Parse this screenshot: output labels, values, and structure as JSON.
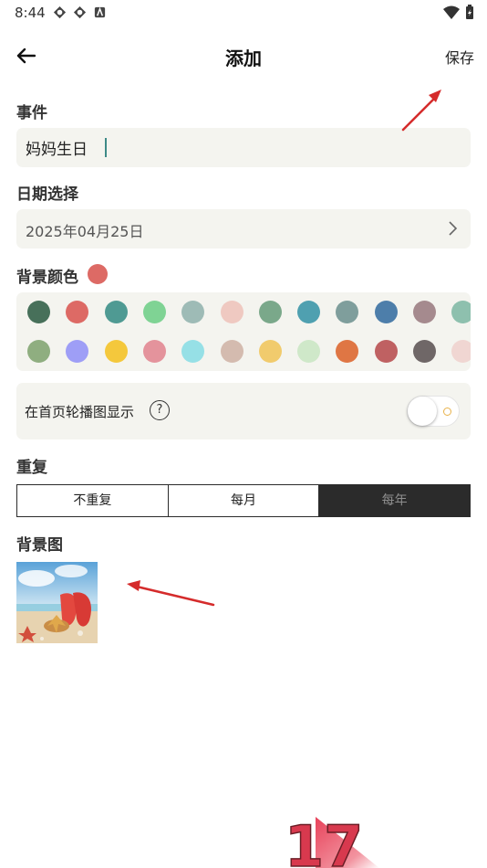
{
  "status_bar": {
    "time": "8:44",
    "icons": [
      "sync-icon",
      "sync-icon",
      "app-icon"
    ],
    "right_icons": [
      "wifi-icon",
      "battery-icon"
    ]
  },
  "header": {
    "title": "添加",
    "save_label": "保存",
    "back_icon": "back-arrow-icon"
  },
  "event": {
    "label": "事件",
    "value": "妈妈生日"
  },
  "date": {
    "label": "日期选择",
    "value": "2025年04月25日"
  },
  "background_color": {
    "label": "背景颜色",
    "selected": "#dd6a65",
    "palette_row1": [
      "#47705a",
      "#dd6a65",
      "#4f9a93",
      "#7fd394",
      "#9ebbb6",
      "#efc9c1",
      "#7aa88a",
      "#4fa0b0",
      "#7f9e9c",
      "#4d7eaa",
      "#a58a8e",
      "#8ec0ae"
    ],
    "palette_row2": [
      "#8fae80",
      "#9e9ef6",
      "#f4c83c",
      "#e4939c",
      "#96e0e6",
      "#d4bbaf",
      "#f1cb6d",
      "#cfe8c9",
      "#df7644",
      "#bf6162",
      "#6f6767",
      "#f0d6d2"
    ]
  },
  "carousel": {
    "label": "在首页轮播图显示",
    "help": "?",
    "enabled": false
  },
  "repeat": {
    "label": "重复",
    "options": [
      "不重复",
      "每月",
      "每年"
    ],
    "selected": "每年"
  },
  "background_image": {
    "label": "背景图"
  },
  "watermark": "17"
}
